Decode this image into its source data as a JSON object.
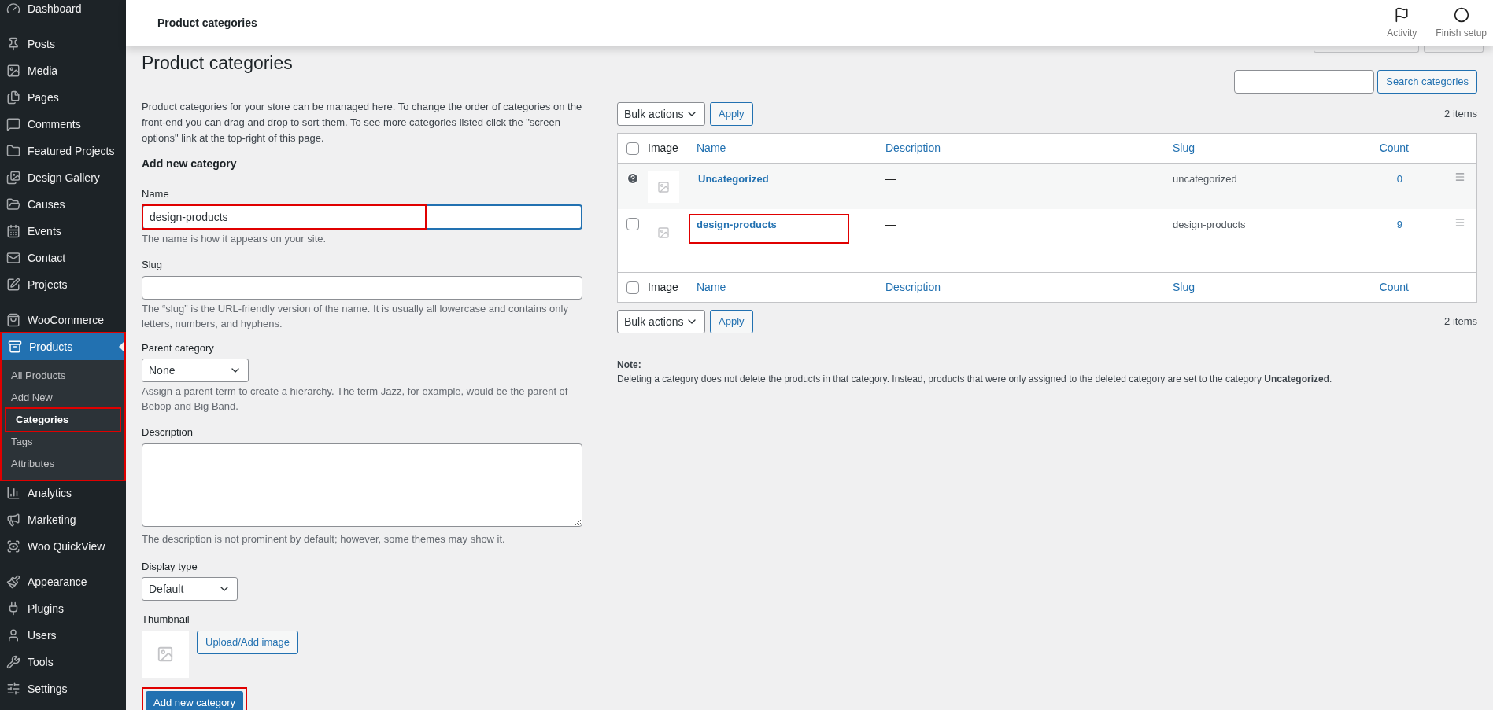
{
  "sidebar": {
    "groups": [
      [
        {
          "label": "Dashboard",
          "selected": false,
          "highlighted": false
        }
      ],
      [
        {
          "label": "Posts",
          "selected": false,
          "highlighted": false
        },
        {
          "label": "Media",
          "selected": false,
          "highlighted": false
        },
        {
          "label": "Pages",
          "selected": false,
          "highlighted": false
        },
        {
          "label": "Comments",
          "selected": false,
          "highlighted": false
        },
        {
          "label": "Featured Projects",
          "selected": false,
          "highlighted": false
        },
        {
          "label": "Design Gallery",
          "selected": false,
          "highlighted": false
        },
        {
          "label": "Causes",
          "selected": false,
          "highlighted": false
        },
        {
          "label": "Events",
          "selected": false,
          "highlighted": false
        },
        {
          "label": "Contact",
          "selected": false,
          "highlighted": false
        },
        {
          "label": "Projects",
          "selected": false,
          "highlighted": false
        }
      ],
      [
        {
          "label": "WooCommerce",
          "selected": false,
          "highlighted": false
        },
        {
          "label": "Products",
          "selected": true,
          "highlighted": true,
          "children": [
            {
              "label": "All Products",
              "selected": false,
              "highlighted": false
            },
            {
              "label": "Add New",
              "selected": false,
              "highlighted": false
            },
            {
              "label": "Categories",
              "selected": true,
              "highlighted": true
            },
            {
              "label": "Tags",
              "selected": false,
              "highlighted": false
            },
            {
              "label": "Attributes",
              "selected": false,
              "highlighted": false
            }
          ]
        },
        {
          "label": "Analytics",
          "selected": false,
          "highlighted": false
        },
        {
          "label": "Marketing",
          "selected": false,
          "highlighted": false
        },
        {
          "label": "Woo QuickView",
          "selected": false,
          "highlighted": false
        }
      ],
      [
        {
          "label": "Appearance",
          "selected": false,
          "highlighted": false
        },
        {
          "label": "Plugins",
          "selected": false,
          "highlighted": false
        },
        {
          "label": "Users",
          "selected": false,
          "highlighted": false
        },
        {
          "label": "Tools",
          "selected": false,
          "highlighted": false
        },
        {
          "label": "Settings",
          "selected": false,
          "highlighted": false
        }
      ]
    ]
  },
  "top_bar": {
    "title": "Product categories",
    "actions": [
      {
        "label": "Activity"
      },
      {
        "label": "Finish setup"
      }
    ]
  },
  "page_title": "Product categories",
  "intro": "Product categories for your store can be managed here. To change the order of categories on the front-end you can drag and drop to sort them. To see more categories listed click the \"screen options\" link at the top-right of this page.",
  "form": {
    "heading": "Add new category",
    "name": {
      "label": "Name",
      "value": "design-products",
      "hint": "The name is how it appears on your site.",
      "highlighted": true
    },
    "slug": {
      "label": "Slug",
      "hint": "The “slug” is the URL-friendly version of the name. It is usually all lowercase and contains only letters, numbers, and hyphens."
    },
    "parent": {
      "label": "Parent category",
      "value": "None",
      "hint": "Assign a parent term to create a hierarchy. The term Jazz, for example, would be the parent of Bebop and Big Band."
    },
    "description": {
      "label": "Description",
      "hint": "The description is not prominent by default; however, some themes may show it."
    },
    "display_type": {
      "label": "Display type",
      "value": "Default"
    },
    "thumbnail": {
      "label": "Thumbnail",
      "button": "Upload/Add image"
    },
    "submit": {
      "label": "Add new category",
      "highlighted": true
    }
  },
  "search": {
    "button": "Search categories"
  },
  "bulk_top": {
    "select": "Bulk actions",
    "apply": "Apply",
    "count": "2 items"
  },
  "table": {
    "header": {
      "checked": false,
      "columns": [
        "Image",
        "Name",
        "Description",
        "Slug",
        "Count"
      ]
    },
    "rows": [
      {
        "kind": "default",
        "name": "Uncategorized",
        "description": "—",
        "slug": "uncategorized",
        "count": "0",
        "highlighted": false
      },
      {
        "kind": "checkbox",
        "checked": false,
        "name": "design-products",
        "description": "—",
        "slug": "design-products",
        "count": "9",
        "highlighted": true
      }
    ],
    "footer": {
      "checked": false,
      "columns": [
        "Image",
        "Name",
        "Description",
        "Slug",
        "Count"
      ]
    }
  },
  "bulk_bottom": {
    "select": "Bulk actions",
    "apply": "Apply",
    "count": "2 items"
  },
  "note": {
    "title": "Note:",
    "text": "Deleting a category does not delete the products in that category. Instead, products that were only assigned to the deleted category are set to the category **Uncategorized**."
  }
}
